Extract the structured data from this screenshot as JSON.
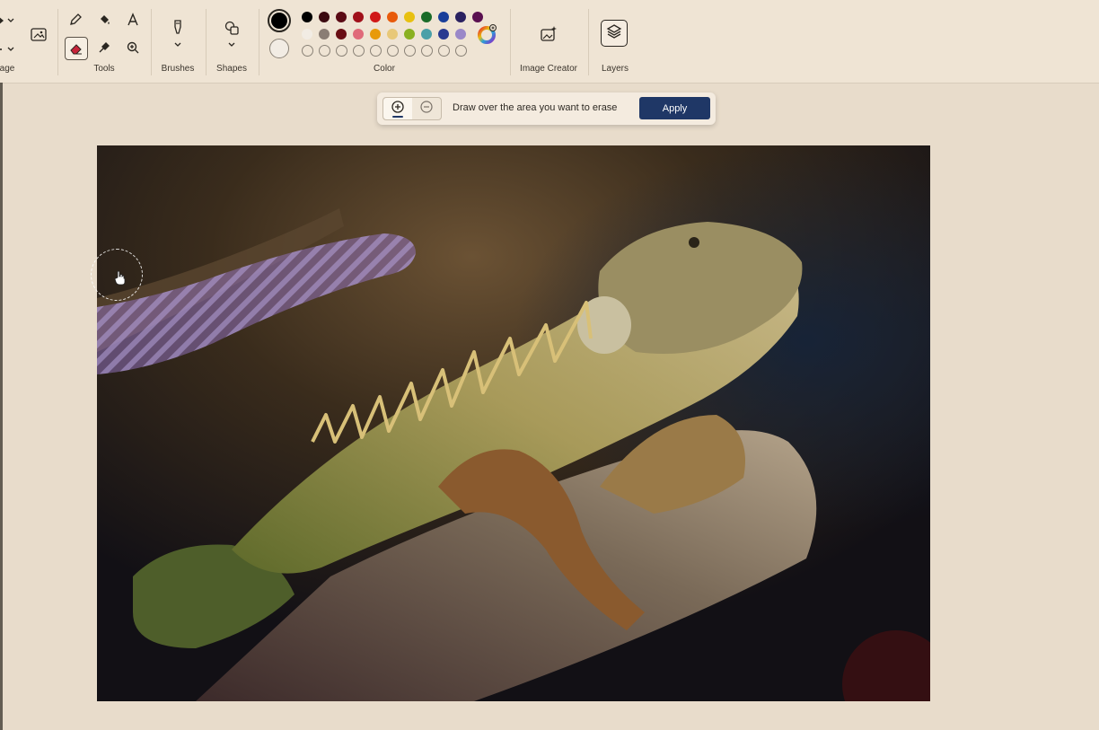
{
  "ribbon": {
    "groups": {
      "image": "age",
      "tools": "Tools",
      "brushes": "Brushes",
      "shapes": "Shapes",
      "color": "Color",
      "image_creator": "Image Creator",
      "layers": "Layers"
    },
    "tools_icons": [
      "pencil-icon",
      "fill-icon",
      "text-icon",
      "eraser-icon",
      "color-picker-icon",
      "magnifier-icon"
    ],
    "selected_tool": "eraser-icon",
    "colors": {
      "primary": "#000000",
      "secondary": "#ffffff",
      "row1": [
        "#000000",
        "#3b0a10",
        "#5a0a14",
        "#a0101a",
        "#d01818",
        "#e85a0a",
        "#e8c010",
        "#1a6b28",
        "#1a3f9a",
        "#2a2160",
        "#5a1050"
      ],
      "row2": [
        "#f2ece4",
        "#8a7d74",
        "#6a0e14",
        "#e06a7a",
        "#e89a0a",
        "#e8c878",
        "#8ab020",
        "#4aa0a8",
        "#2a3a90",
        "#9a88c8"
      ],
      "row3_count": 10
    }
  },
  "erase_bar": {
    "message": "Draw over the area you want to erase",
    "apply_label": "Apply",
    "add_mode_active": true
  },
  "canvas": {
    "subject": "iguana-photo"
  }
}
